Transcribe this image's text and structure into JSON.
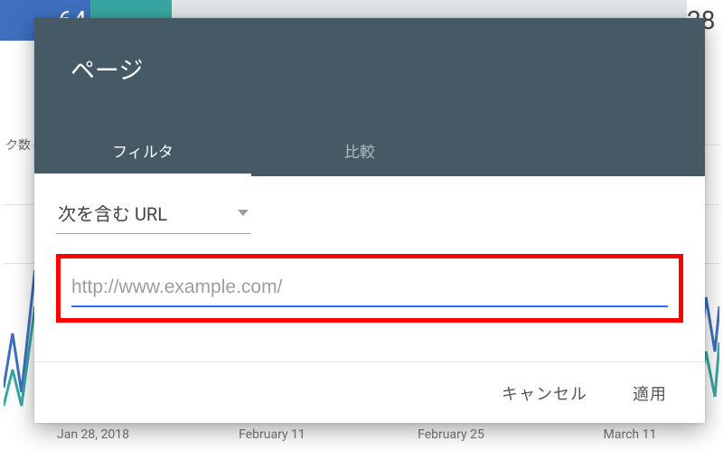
{
  "background": {
    "metric_left_fragment": "64",
    "metric_right_fragment": "28",
    "y_label_fragment": "ク数",
    "dates": [
      "Jan 28, 2018",
      "February 11",
      "February 25",
      "March 11"
    ]
  },
  "modal": {
    "title": "ページ",
    "tabs": {
      "filter": "フィルタ",
      "compare": "比較"
    },
    "dropdown": {
      "label": "次を含む URL"
    },
    "url_input": {
      "value": "",
      "placeholder": "http://www.example.com/"
    },
    "buttons": {
      "cancel": "キャンセル",
      "apply": "適用"
    }
  }
}
